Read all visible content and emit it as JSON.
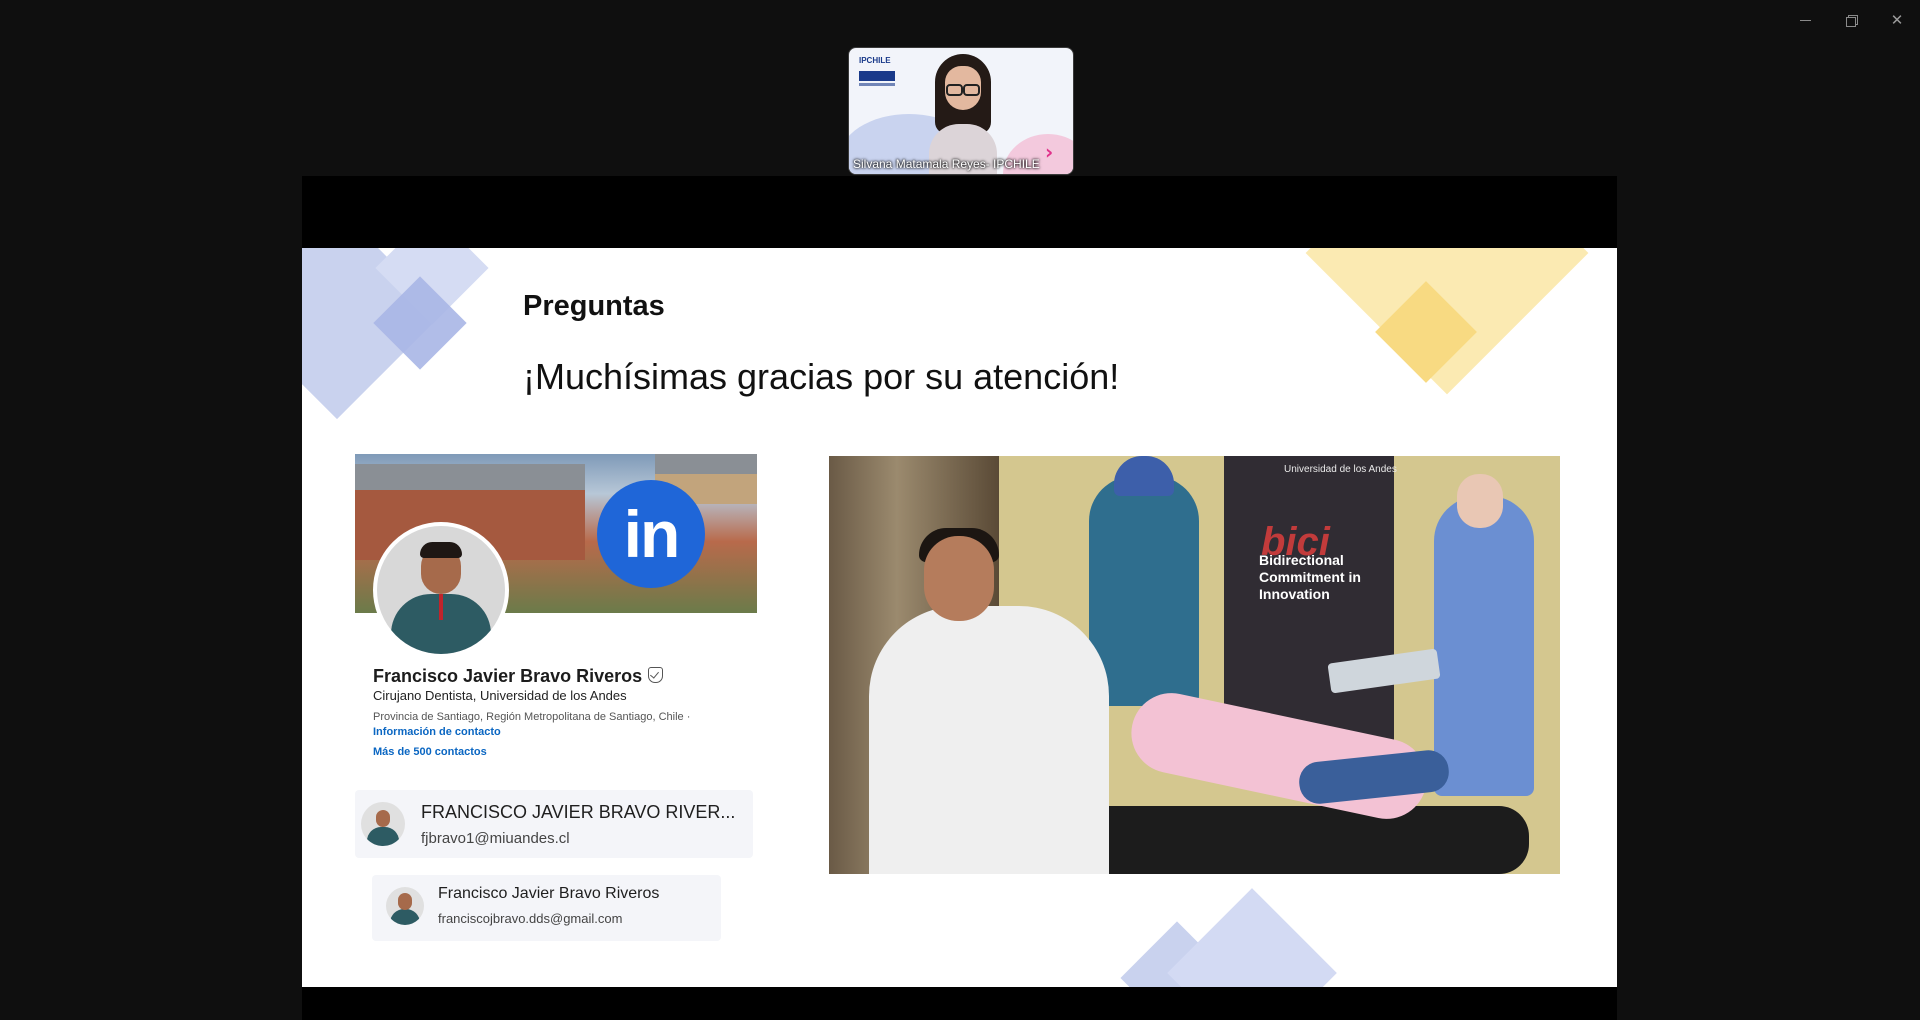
{
  "window": {
    "controls": {
      "minimize_icon": "minimize-icon",
      "restore_icon": "restore-icon",
      "close_icon": "close-icon"
    }
  },
  "participant": {
    "name": "Silvana Matamala Reyes- IPCHILE",
    "tile_logo": "IPCHILE"
  },
  "slide": {
    "title": "Preguntas",
    "subtitle": "¡Muchísimas gracias por su atención!",
    "linkedin": {
      "logo_text": "in",
      "name": "Francisco Javier Bravo Riveros",
      "headline": "Cirujano Dentista, Universidad de los Andes",
      "location": "Provincia de Santiago, Región Metropolitana de Santiago, Chile ·",
      "contact_info": "Información de contacto",
      "connections": "Más de 500 contactos"
    },
    "contacts": [
      {
        "name": "FRANCISCO JAVIER BRAVO RIVER...",
        "email": "fjbravo1@miuandes.cl"
      },
      {
        "name": "Francisco Javier Bravo Riveros",
        "email": "franciscojbravo.dds@gmail.com"
      }
    ],
    "photo": {
      "banner_org": "Universidad de los Andes",
      "banner_logo": "bici",
      "banner_text": "Bidirectional Commitment in Innovation"
    }
  },
  "colors": {
    "blue_diamond": "#c7d0ee",
    "yellow_diamond": "#f9e6a6",
    "linkedin_blue": "#1f66d8",
    "link_blue": "#0a66c2"
  }
}
